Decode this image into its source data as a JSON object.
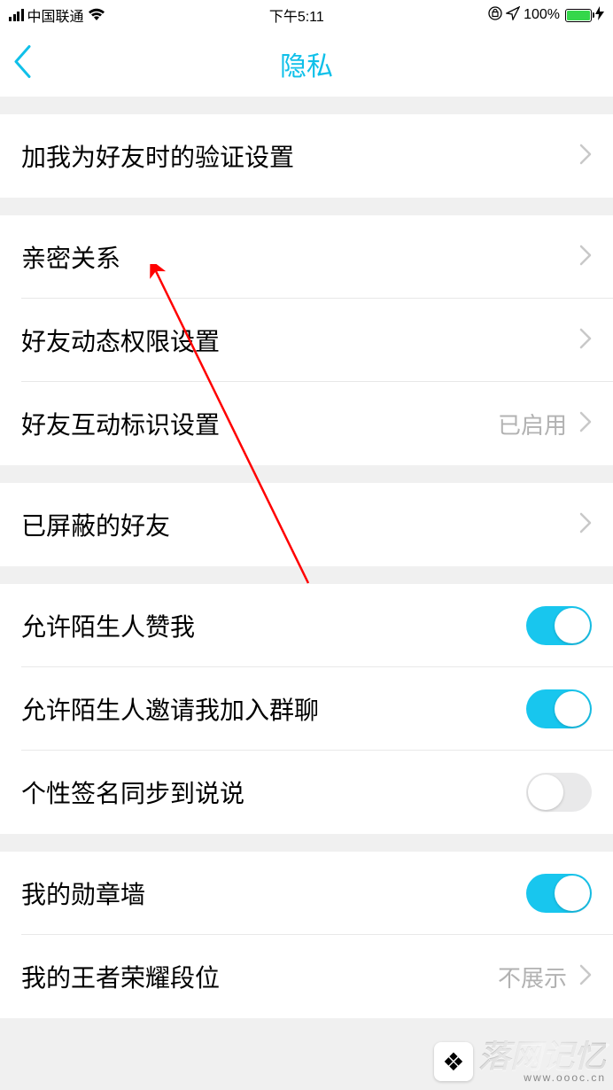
{
  "statusBar": {
    "carrier": "中国联通",
    "time": "下午5:11",
    "battery": "100%",
    "lockIcon": "⊕",
    "locationIcon": "◀",
    "chargeIcon": "✦"
  },
  "nav": {
    "title": "隐私"
  },
  "groups": [
    {
      "items": [
        {
          "label": "加我为好友时的验证设置",
          "type": "chevron",
          "value": ""
        }
      ]
    },
    {
      "items": [
        {
          "label": "亲密关系",
          "type": "chevron",
          "value": ""
        },
        {
          "label": "好友动态权限设置",
          "type": "chevron",
          "value": ""
        },
        {
          "label": "好友互动标识设置",
          "type": "chevron",
          "value": "已启用"
        }
      ]
    },
    {
      "items": [
        {
          "label": "已屏蔽的好友",
          "type": "chevron",
          "value": ""
        }
      ]
    },
    {
      "items": [
        {
          "label": "允许陌生人赞我",
          "type": "toggle",
          "on": true
        },
        {
          "label": "允许陌生人邀请我加入群聊",
          "type": "toggle",
          "on": true
        },
        {
          "label": "个性签名同步到说说",
          "type": "toggle",
          "on": false
        }
      ]
    },
    {
      "items": [
        {
          "label": "我的勋章墙",
          "type": "toggle",
          "on": true
        },
        {
          "label": "我的王者荣耀段位",
          "type": "chevron",
          "value": "不展示"
        }
      ]
    }
  ],
  "watermark": {
    "main": "落网记忆",
    "sub": "www.oooc.cn"
  }
}
